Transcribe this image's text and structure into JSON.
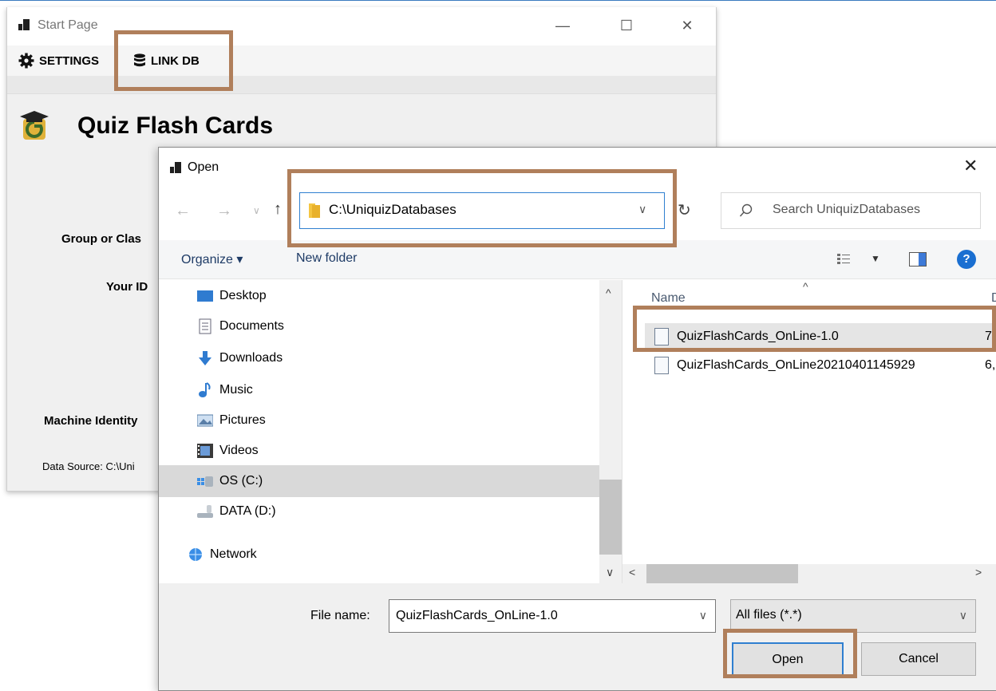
{
  "start_window": {
    "title": "Start Page",
    "toolbar": {
      "settings_label": "SETTINGS",
      "link_db_label": "LINK DB"
    },
    "app_title": "Quiz Flash Cards",
    "labels": {
      "group_or_class": "Group or Clas",
      "your_id": "Your ID",
      "machine_identity": "Machine Identity",
      "data_source": "Data Source: C:\\Uni"
    }
  },
  "open_dialog": {
    "title": "Open",
    "address_path": "C:\\UniquizDatabases",
    "search_placeholder": "Search UniquizDatabases",
    "commands": {
      "organize": "Organize ▾",
      "new_folder": "New folder",
      "help": "?"
    },
    "nav_items": [
      {
        "label": "Desktop",
        "icon": "desktop-icon"
      },
      {
        "label": "Documents",
        "icon": "documents-icon"
      },
      {
        "label": "Downloads",
        "icon": "downloads-icon"
      },
      {
        "label": "Music",
        "icon": "music-icon"
      },
      {
        "label": "Pictures",
        "icon": "pictures-icon"
      },
      {
        "label": "Videos",
        "icon": "videos-icon"
      },
      {
        "label": "OS (C:)",
        "icon": "drive-c-icon",
        "selected": true
      },
      {
        "label": "DATA (D:)",
        "icon": "drive-d-icon"
      },
      {
        "label": "Network",
        "icon": "network-icon"
      }
    ],
    "file_list": {
      "column_name": "Name",
      "column_date_partial": "D",
      "files": [
        {
          "name": "QuizFlashCards_OnLine-1.0",
          "date_partial": "7",
          "selected": true
        },
        {
          "name": "QuizFlashCards_OnLine20210401145929",
          "date_partial": "6,"
        }
      ]
    },
    "file_name_label": "File name:",
    "file_name_value": "QuizFlashCards_OnLine-1.0",
    "file_type_filter": "All files (*.*)",
    "open_button": "Open",
    "cancel_button": "Cancel"
  },
  "colors": {
    "highlight": "#b07f5b",
    "accent": "#2f7fd0"
  }
}
